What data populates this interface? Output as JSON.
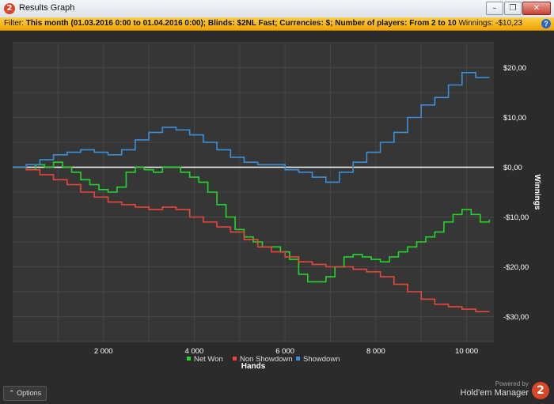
{
  "window": {
    "title": "Results Graph",
    "app_icon": "2",
    "buttons": [
      {
        "name": "minimize-button",
        "glyph": "–"
      },
      {
        "name": "restore-button",
        "glyph": "❐"
      },
      {
        "name": "close-button",
        "glyph": "✕"
      }
    ]
  },
  "filter": {
    "label": "Filter:",
    "text": "This month (01.03.2016 0:00 to 01.04.2016 0:00); Blinds: $2NL Fast; Currencies: $; Number of players: From 2 to 10",
    "winnings_label": "Winnings:",
    "winnings_value": "-$10,23",
    "help_icon": "?"
  },
  "options_button": "Options",
  "footer": {
    "powered_by": "Powered by",
    "brand": "Hold'em Manager",
    "brand_logo": "2"
  },
  "chart_data": {
    "type": "line",
    "xlabel": "Hands",
    "ylabel": "Winnings",
    "xlim": [
      0,
      10600
    ],
    "ylim": [
      -35,
      25
    ],
    "xticks": [
      2000,
      4000,
      6000,
      8000,
      10000
    ],
    "xtick_labels": [
      "2 000",
      "4 000",
      "6 000",
      "8 000",
      "10 000"
    ],
    "yticks": [
      20,
      10,
      0,
      -10,
      -20,
      -30
    ],
    "ytick_labels": [
      "$20,00",
      "$10,00",
      "$0,00",
      "-$10,00",
      "-$20,00",
      "-$30,00"
    ],
    "grid": true,
    "legend_position": "bottom",
    "series": [
      {
        "name": "Net Won",
        "color": "#22d52b",
        "x": [
          0,
          300,
          500,
          700,
          900,
          1100,
          1300,
          1500,
          1700,
          1900,
          2100,
          2300,
          2500,
          2700,
          2900,
          3100,
          3300,
          3500,
          3700,
          3900,
          4100,
          4300,
          4500,
          4700,
          4900,
          5100,
          5300,
          5500,
          5700,
          5900,
          6100,
          6300,
          6500,
          6700,
          6900,
          7100,
          7300,
          7500,
          7700,
          7900,
          8100,
          8300,
          8500,
          8700,
          8900,
          9100,
          9300,
          9500,
          9700,
          9900,
          10100,
          10300,
          10500
        ],
        "y": [
          0,
          -0.5,
          0.5,
          0,
          1,
          0,
          -1,
          -2.5,
          -3.5,
          -4.5,
          -5,
          -4,
          -1,
          0,
          -0.5,
          -1,
          0,
          0,
          -1,
          -2,
          -3,
          -5,
          -7.5,
          -10,
          -12.5,
          -14,
          -15,
          -16,
          -16,
          -17,
          -18.5,
          -21.5,
          -23,
          -23,
          -22,
          -20,
          -18,
          -17.5,
          -18,
          -18.5,
          -19,
          -18,
          -17,
          -16,
          -15,
          -14,
          -13,
          -11,
          -9.5,
          -8.5,
          -9.5,
          -11,
          -10.5
        ]
      },
      {
        "name": "Non Showdown",
        "color": "#e8453c",
        "x": [
          0,
          300,
          600,
          900,
          1200,
          1500,
          1800,
          2100,
          2400,
          2700,
          3000,
          3300,
          3600,
          3900,
          4200,
          4500,
          4800,
          5100,
          5400,
          5700,
          6000,
          6300,
          6600,
          6900,
          7200,
          7500,
          7800,
          8100,
          8400,
          8700,
          9000,
          9300,
          9600,
          9900,
          10200,
          10500
        ],
        "y": [
          0,
          -0.5,
          -1.5,
          -2.5,
          -3.5,
          -5,
          -6,
          -7,
          -7.5,
          -8,
          -8.5,
          -8,
          -8.5,
          -10,
          -11,
          -12,
          -13,
          -14.5,
          -16,
          -17,
          -18,
          -19,
          -19.5,
          -20,
          -20,
          -20.5,
          -21,
          -22,
          -23.5,
          -25,
          -26.5,
          -27.5,
          -28,
          -28.5,
          -29,
          -29
        ]
      },
      {
        "name": "Showdown",
        "color": "#3b8fd9",
        "x": [
          0,
          300,
          600,
          900,
          1200,
          1500,
          1800,
          2100,
          2400,
          2700,
          3000,
          3300,
          3600,
          3900,
          4200,
          4500,
          4800,
          5100,
          5400,
          5700,
          6000,
          6300,
          6600,
          6900,
          7200,
          7500,
          7800,
          8100,
          8400,
          8700,
          9000,
          9300,
          9600,
          9900,
          10200,
          10500
        ],
        "y": [
          0,
          0.5,
          1.5,
          2.5,
          3,
          3.5,
          3,
          2.5,
          3.5,
          5.5,
          7,
          8,
          7.5,
          6.5,
          5,
          3.5,
          2,
          1,
          0.5,
          0.5,
          -0.5,
          -1,
          -2,
          -3,
          -1,
          1,
          3,
          5,
          7,
          10,
          12.5,
          14,
          16.5,
          19,
          18,
          18
        ]
      }
    ]
  }
}
